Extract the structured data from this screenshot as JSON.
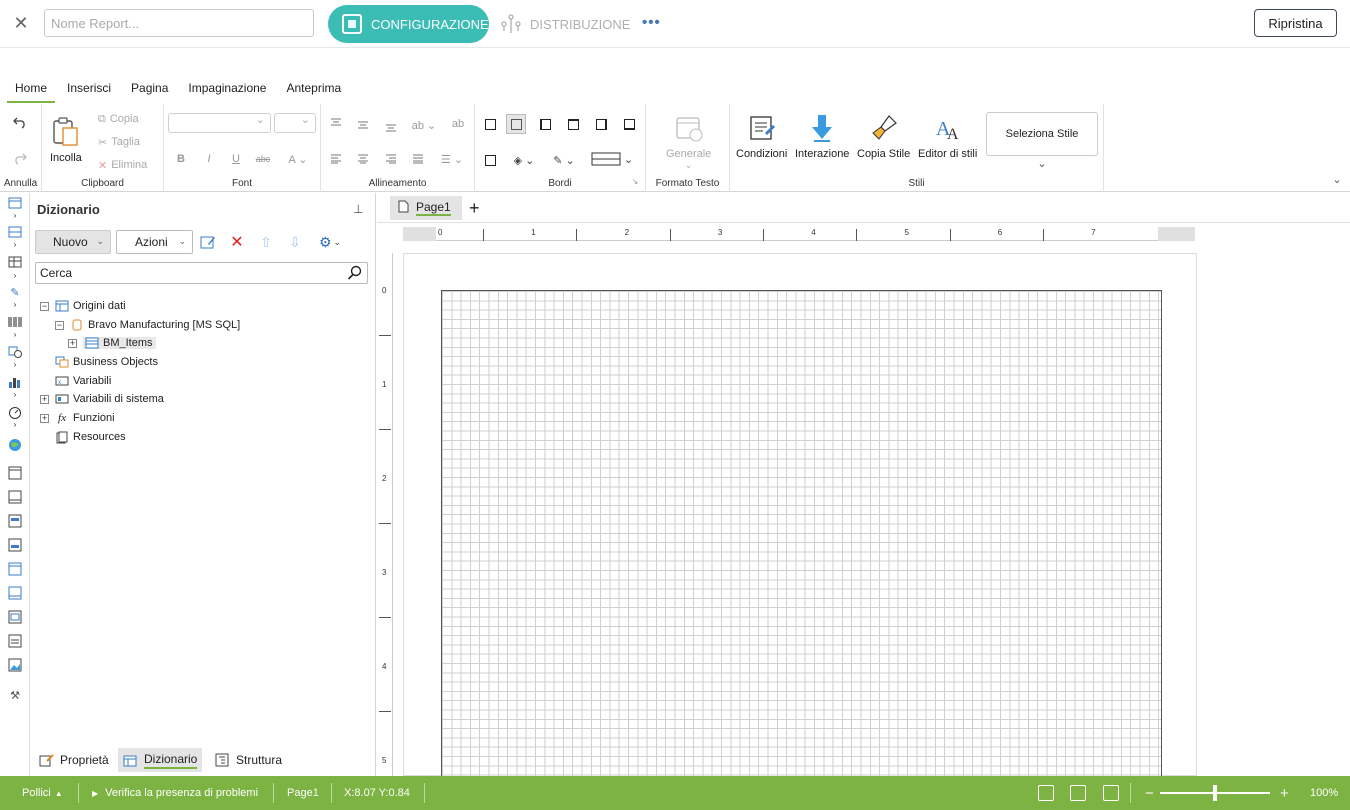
{
  "topbar": {
    "name_placeholder": "Nome Report...",
    "config_label": "CONFIGURAZIONE",
    "distr_label": "DISTRIBUZIONE",
    "more_label": "•••",
    "reset_label": "Ripristina"
  },
  "ribbon_tabs": [
    "Home",
    "Inserisci",
    "Pagina",
    "Impaginazione",
    "Anteprima"
  ],
  "ribbon": {
    "annulla_label": "Annulla",
    "clipboard": {
      "label": "Clipboard",
      "incolla": "Incolla",
      "copia": "Copia",
      "taglia": "Taglia",
      "elimina": "Elimina"
    },
    "font_label": "Font",
    "allineamento_label": "Allineamento",
    "bordi_label": "Bordi",
    "formato": {
      "label": "Formato Testo",
      "generale": "Generale"
    },
    "stili": {
      "label": "Stili",
      "condizioni": "Condizioni",
      "interazione": "Interazione",
      "copia_stile": "Copia Stile",
      "editor": "Editor di stili",
      "seleziona": "Seleziona Stile"
    }
  },
  "dictionary": {
    "title": "Dizionario",
    "nuovo": "Nuovo",
    "azioni": "Azioni",
    "search_value": "Cerca",
    "tree": {
      "origini": "Origini dati",
      "bravo": "Bravo Manufacturing [MS SQL]",
      "bm_items": "BM_Items",
      "business": "Business Objects",
      "variabili": "Variabili",
      "variabili_sistema": "Variabili di sistema",
      "funzioni": "Funzioni",
      "resources": "Resources"
    }
  },
  "bottom_tabs": {
    "proprieta": "Proprietà",
    "dizionario": "Dizionario",
    "struttura": "Struttura"
  },
  "page_tab": "Page1",
  "ruler": {
    "h": [
      "0",
      "1",
      "2",
      "3",
      "4",
      "5",
      "6",
      "7"
    ],
    "v": [
      "0",
      "1",
      "2",
      "3",
      "4",
      "5"
    ]
  },
  "status": {
    "units": "Pollici",
    "verify": "Verifica la presenza di problemi",
    "page": "Page1",
    "coords": "X:8.07 Y:0.84",
    "zoom_minus": "−",
    "zoom_plus": "+",
    "zoom": "100%"
  },
  "colors": {
    "accent": "#7cb342",
    "config": "#3bbcb4"
  }
}
